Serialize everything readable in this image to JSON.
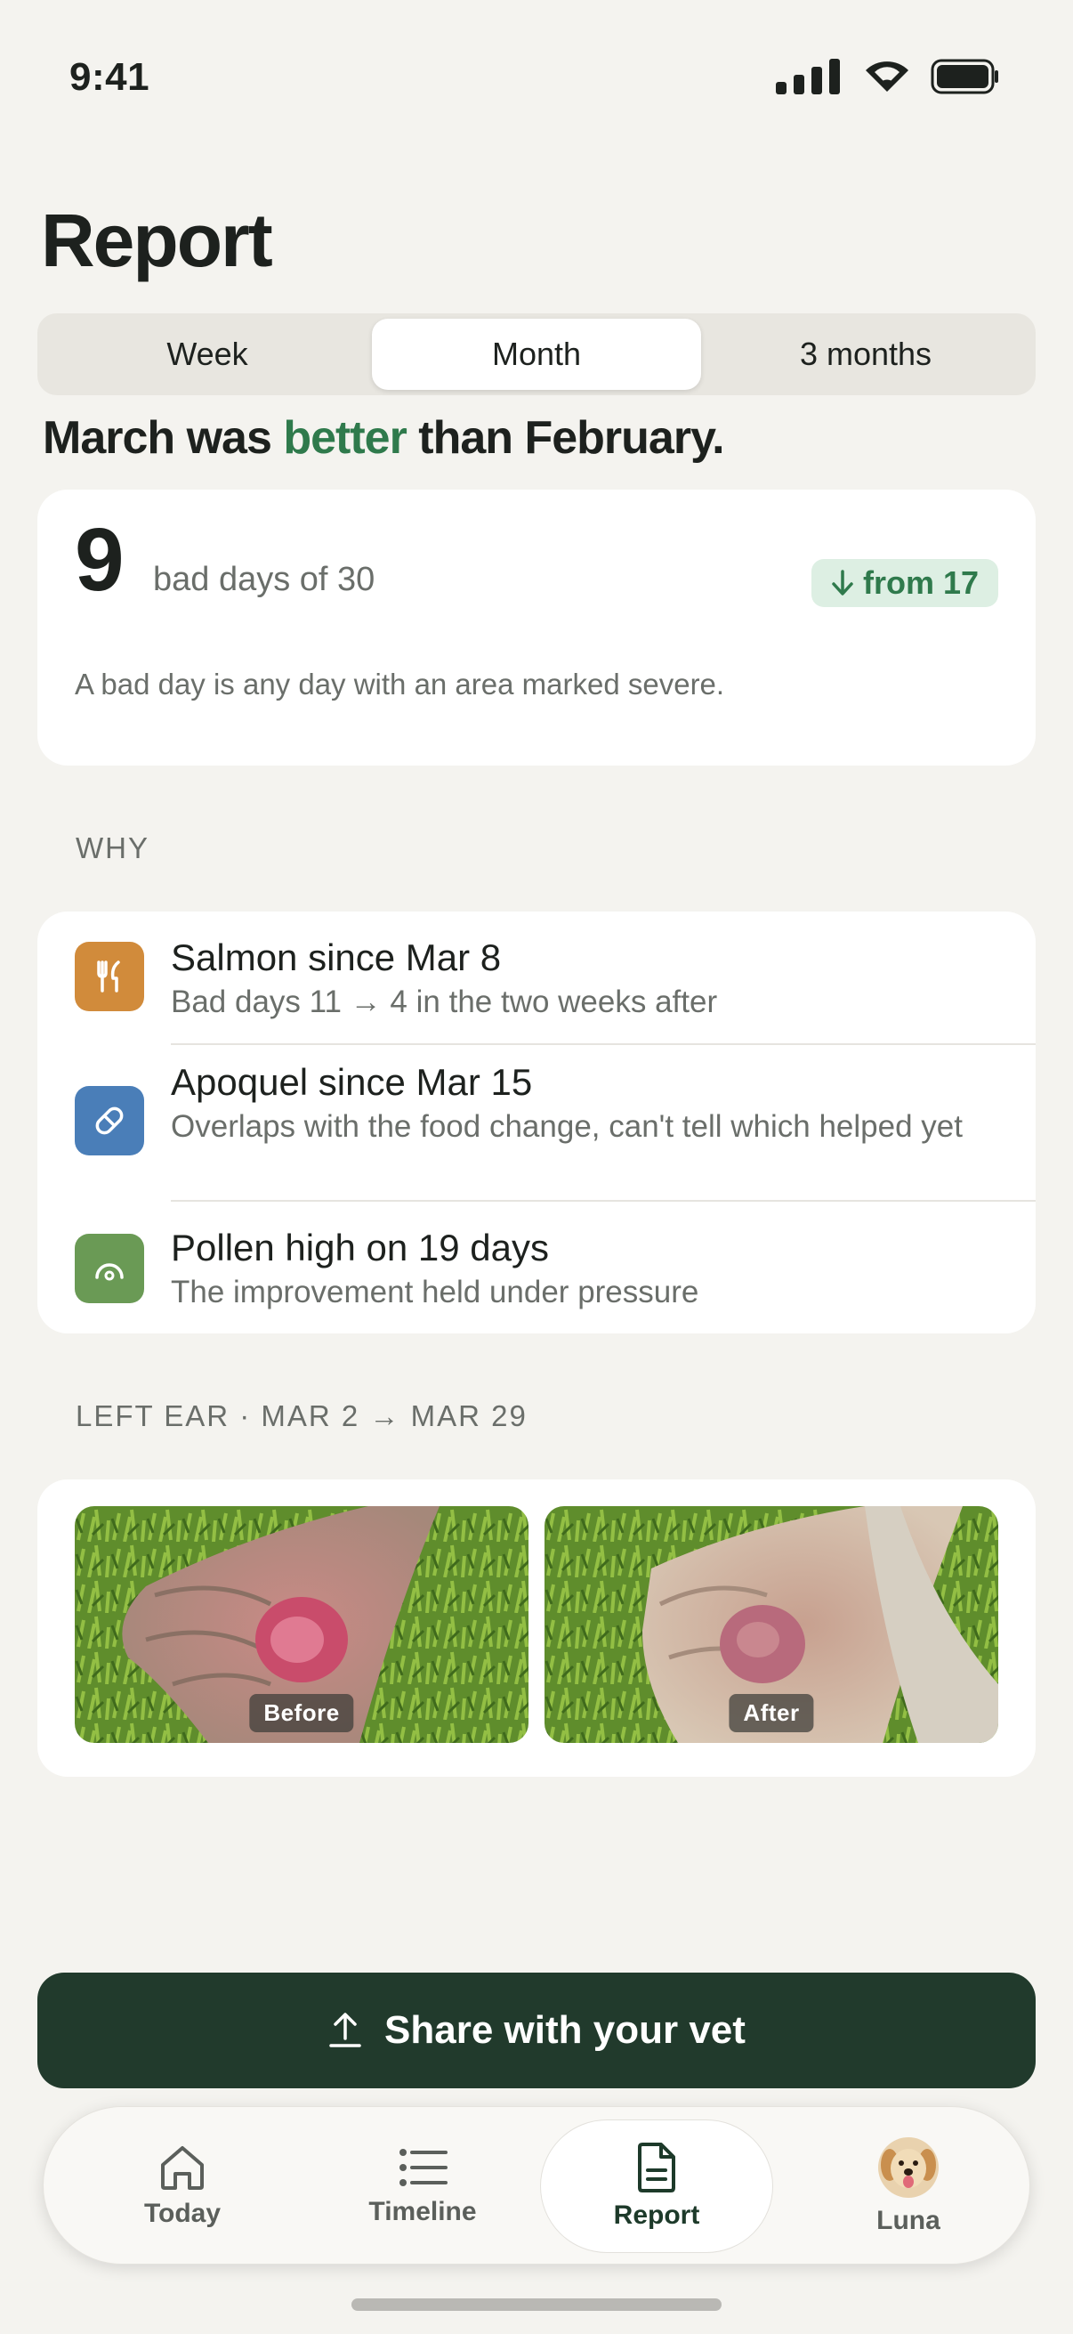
{
  "status_bar": {
    "time": "9:41"
  },
  "page": {
    "title": "Report"
  },
  "segments": {
    "week": "Week",
    "month": "Month",
    "three_months": "3 months",
    "selected": "Month"
  },
  "headline": {
    "prefix": "March was ",
    "accent": "better",
    "suffix": " than February."
  },
  "summary": {
    "bad_days": "9",
    "bad_days_label": "bad days of 30",
    "delta": "from 17",
    "definition": "A bad day is any day with an area marked severe."
  },
  "why": {
    "label": "WHY",
    "items": [
      {
        "title": "Salmon since Mar 8",
        "subtitle": "Bad days 11 → 4 in the two weeks after",
        "icon": "fork-knife-icon",
        "color": "#d18b3b"
      },
      {
        "title": "Apoquel since Mar 15",
        "subtitle": "Overlaps with the food change, can't tell which helped yet",
        "icon": "pill-icon",
        "color": "#4a7eb8"
      },
      {
        "title": "Pollen high on 19 days",
        "subtitle": "The improvement held under pressure",
        "icon": "pollen-icon",
        "color": "#6a9a55"
      }
    ]
  },
  "photos": {
    "label": "LEFT EAR · MAR 2 → MAR 29",
    "before": "Before",
    "after": "After"
  },
  "share_button": {
    "label": "Share with your vet"
  },
  "tabs": {
    "today": "Today",
    "timeline": "Timeline",
    "report": "Report",
    "profile": "Luna"
  },
  "colors": {
    "accent": "#2f7a4c",
    "button": "#213a2c",
    "background": "#f4f3ef"
  }
}
